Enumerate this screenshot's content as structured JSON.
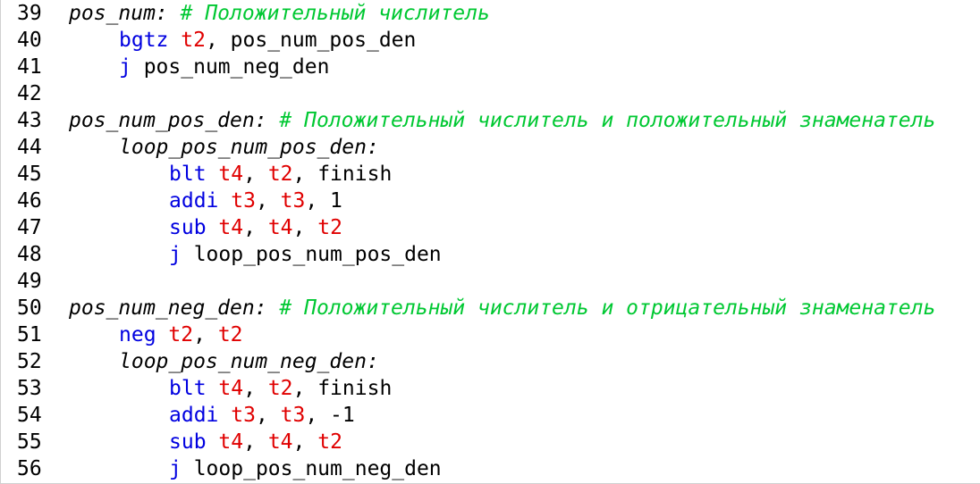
{
  "editor": {
    "lines": [
      {
        "number": "39",
        "indent": 0,
        "tokens": [
          {
            "text": "pos_num:",
            "kind": "label"
          },
          {
            "text": " ",
            "kind": "plain"
          },
          {
            "text": "# Положительный числитель",
            "kind": "comment"
          }
        ]
      },
      {
        "number": "40",
        "indent": 1,
        "tokens": [
          {
            "text": "bgtz",
            "kind": "instr"
          },
          {
            "text": " ",
            "kind": "plain"
          },
          {
            "text": "t2",
            "kind": "reg"
          },
          {
            "text": ", pos_num_pos_den",
            "kind": "plain"
          }
        ]
      },
      {
        "number": "41",
        "indent": 1,
        "tokens": [
          {
            "text": "j",
            "kind": "instr"
          },
          {
            "text": " pos_num_neg_den",
            "kind": "plain"
          }
        ]
      },
      {
        "number": "42",
        "indent": 0,
        "tokens": []
      },
      {
        "number": "43",
        "indent": 0,
        "tokens": [
          {
            "text": "pos_num_pos_den:",
            "kind": "label"
          },
          {
            "text": " ",
            "kind": "plain"
          },
          {
            "text": "# Положительный числитель и положительный знаменатель",
            "kind": "comment"
          }
        ]
      },
      {
        "number": "44",
        "indent": 1,
        "tokens": [
          {
            "text": "loop_pos_num_pos_den:",
            "kind": "label"
          }
        ]
      },
      {
        "number": "45",
        "indent": 2,
        "tokens": [
          {
            "text": "blt",
            "kind": "instr"
          },
          {
            "text": " ",
            "kind": "plain"
          },
          {
            "text": "t4",
            "kind": "reg"
          },
          {
            "text": ", ",
            "kind": "plain"
          },
          {
            "text": "t2",
            "kind": "reg"
          },
          {
            "text": ", finish",
            "kind": "plain"
          }
        ]
      },
      {
        "number": "46",
        "indent": 2,
        "tokens": [
          {
            "text": "addi",
            "kind": "instr"
          },
          {
            "text": " ",
            "kind": "plain"
          },
          {
            "text": "t3",
            "kind": "reg"
          },
          {
            "text": ", ",
            "kind": "plain"
          },
          {
            "text": "t3",
            "kind": "reg"
          },
          {
            "text": ", 1",
            "kind": "plain"
          }
        ]
      },
      {
        "number": "47",
        "indent": 2,
        "tokens": [
          {
            "text": "sub",
            "kind": "instr"
          },
          {
            "text": " ",
            "kind": "plain"
          },
          {
            "text": "t4",
            "kind": "reg"
          },
          {
            "text": ", ",
            "kind": "plain"
          },
          {
            "text": "t4",
            "kind": "reg"
          },
          {
            "text": ", ",
            "kind": "plain"
          },
          {
            "text": "t2",
            "kind": "reg"
          }
        ]
      },
      {
        "number": "48",
        "indent": 2,
        "tokens": [
          {
            "text": "j",
            "kind": "instr"
          },
          {
            "text": " loop_pos_num_pos_den",
            "kind": "plain"
          }
        ]
      },
      {
        "number": "49",
        "indent": 0,
        "tokens": []
      },
      {
        "number": "50",
        "indent": 0,
        "tokens": [
          {
            "text": "pos_num_neg_den:",
            "kind": "label"
          },
          {
            "text": " ",
            "kind": "plain"
          },
          {
            "text": "# Положительный числитель и отрицательный знаменатель",
            "kind": "comment"
          }
        ]
      },
      {
        "number": "51",
        "indent": 1,
        "tokens": [
          {
            "text": "neg",
            "kind": "instr"
          },
          {
            "text": " ",
            "kind": "plain"
          },
          {
            "text": "t2",
            "kind": "reg"
          },
          {
            "text": ", ",
            "kind": "plain"
          },
          {
            "text": "t2",
            "kind": "reg"
          }
        ]
      },
      {
        "number": "52",
        "indent": 1,
        "tokens": [
          {
            "text": "loop_pos_num_neg_den:",
            "kind": "label"
          }
        ]
      },
      {
        "number": "53",
        "indent": 2,
        "tokens": [
          {
            "text": "blt",
            "kind": "instr"
          },
          {
            "text": " ",
            "kind": "plain"
          },
          {
            "text": "t4",
            "kind": "reg"
          },
          {
            "text": ", ",
            "kind": "plain"
          },
          {
            "text": "t2",
            "kind": "reg"
          },
          {
            "text": ", finish",
            "kind": "plain"
          }
        ]
      },
      {
        "number": "54",
        "indent": 2,
        "tokens": [
          {
            "text": "addi",
            "kind": "instr"
          },
          {
            "text": " ",
            "kind": "plain"
          },
          {
            "text": "t3",
            "kind": "reg"
          },
          {
            "text": ", ",
            "kind": "plain"
          },
          {
            "text": "t3",
            "kind": "reg"
          },
          {
            "text": ", -1",
            "kind": "plain"
          }
        ]
      },
      {
        "number": "55",
        "indent": 2,
        "tokens": [
          {
            "text": "sub",
            "kind": "instr"
          },
          {
            "text": " ",
            "kind": "plain"
          },
          {
            "text": "t4",
            "kind": "reg"
          },
          {
            "text": ", ",
            "kind": "plain"
          },
          {
            "text": "t4",
            "kind": "reg"
          },
          {
            "text": ", ",
            "kind": "plain"
          },
          {
            "text": "t2",
            "kind": "reg"
          }
        ]
      },
      {
        "number": "56",
        "indent": 2,
        "tokens": [
          {
            "text": "j",
            "kind": "instr"
          },
          {
            "text": " loop_pos_num_neg_den",
            "kind": "plain"
          }
        ]
      }
    ]
  },
  "colors": {
    "label": "#000000",
    "comment": "#00c832",
    "instr": "#0000e0",
    "reg": "#e00000",
    "plain": "#000000",
    "line_number": "#000000",
    "background": "#ffffff"
  }
}
